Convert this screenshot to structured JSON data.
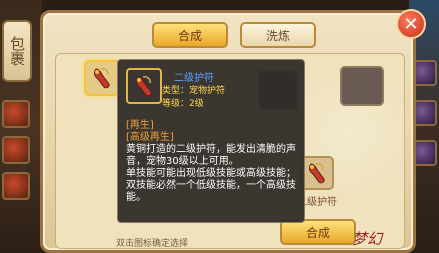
{
  "sidebar": {
    "bag_tab_label": "包裹"
  },
  "tabs": {
    "combine": "合成",
    "refine": "洗炼"
  },
  "close_icon_glyph": "✕",
  "tooltip": {
    "item_name": "二级护符",
    "item_type": "类型：宠物护符",
    "item_level": "等级：2级",
    "skill_1": "[再生]",
    "skill_2": "[高级再生]",
    "description": "黄铜打造的二级护符，能发出清脆的声音，宠物30级以上可用。",
    "skill_note": "单技能可能出现低级技能或高级技能；双技能必然一个低级技能，一个高级技能。"
  },
  "result": {
    "label": "二级护符"
  },
  "buttons": {
    "craft": "合成"
  },
  "hint": "双击图标确定选择",
  "logo_text": "梦幻",
  "colors": {
    "accent_gold": "#e9a82a",
    "item_name_blue": "#5aa0ff",
    "skill_orange": "#f0a040",
    "close_red": "#c2301a"
  }
}
